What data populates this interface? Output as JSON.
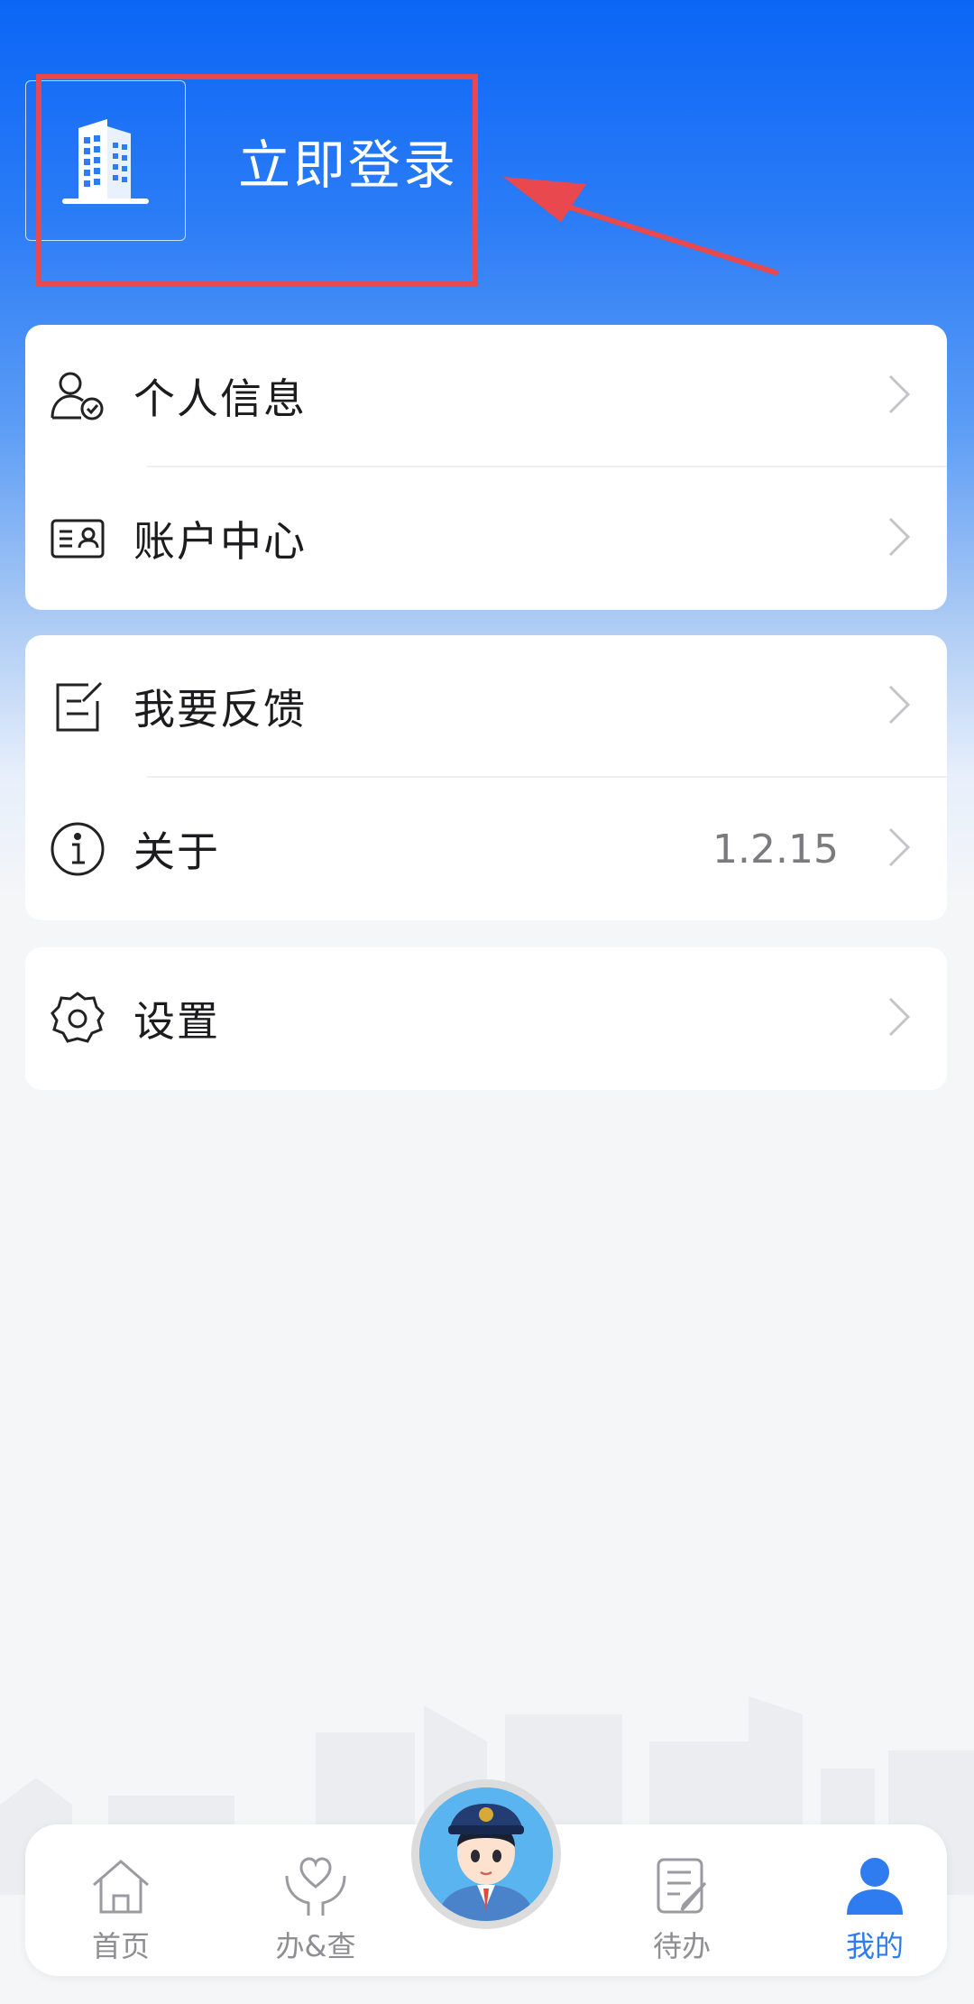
{
  "header": {
    "login_label": "立即登录"
  },
  "menu_group_1": [
    {
      "label": "个人信息",
      "icon": "person-check-icon"
    },
    {
      "label": "账户中心",
      "icon": "id-card-icon"
    }
  ],
  "menu_group_2": [
    {
      "label": "我要反馈",
      "icon": "edit-note-icon"
    },
    {
      "label": "关于",
      "value": "1.2.15",
      "icon": "info-icon"
    }
  ],
  "menu_group_3": [
    {
      "label": "设置",
      "icon": "gear-icon"
    }
  ],
  "tabbar": {
    "tabs": [
      {
        "label": "首页",
        "icon": "home-icon"
      },
      {
        "label": "办&查",
        "icon": "heart-hand-icon"
      },
      {
        "label": "待办",
        "icon": "todo-icon"
      },
      {
        "label": "我的",
        "icon": "user-icon",
        "active": true
      }
    ],
    "center": {
      "icon": "officer-avatar-icon"
    }
  },
  "colors": {
    "brand_blue": "#0b66f6",
    "active_tab": "#2f7cf0",
    "annotation_red": "#e8484e"
  }
}
